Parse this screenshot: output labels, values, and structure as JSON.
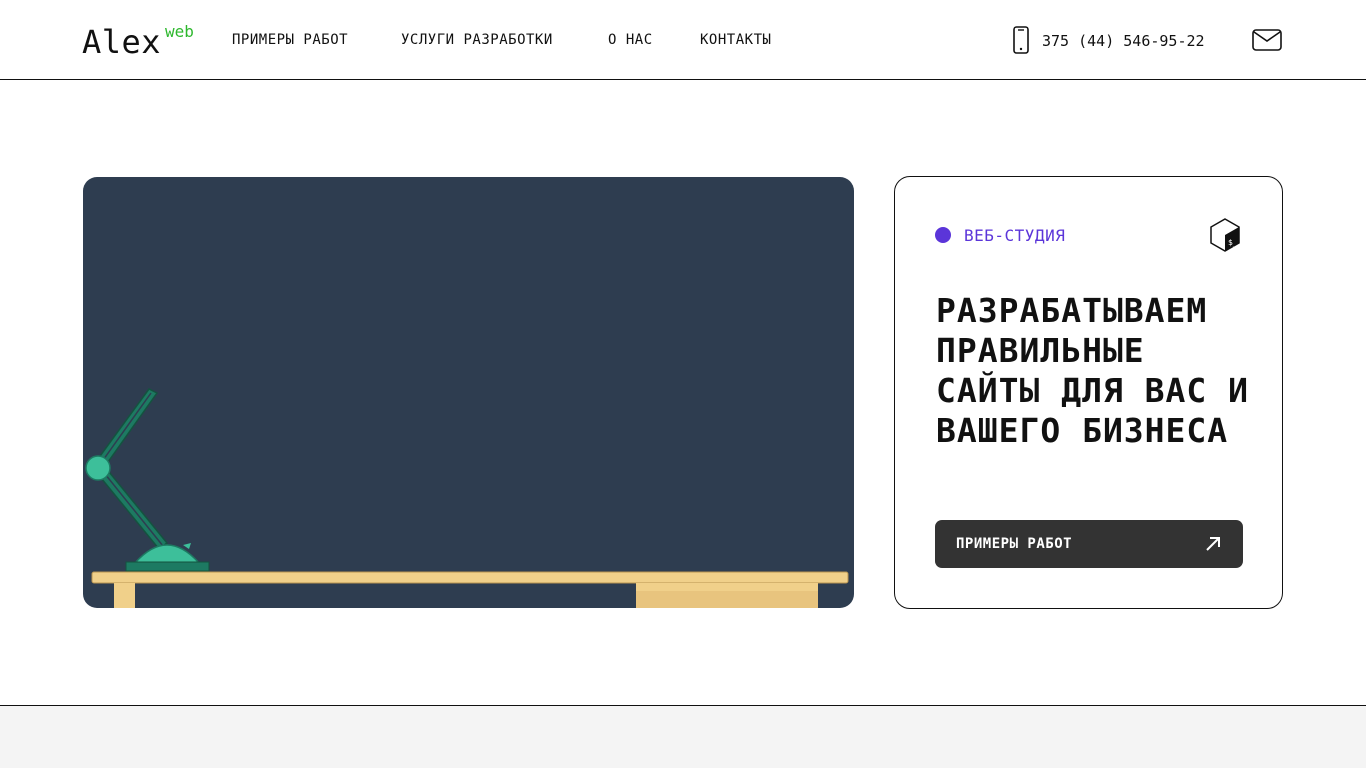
{
  "header": {
    "logo": "Alex",
    "logo_sup": "web",
    "nav": [
      {
        "label": "ПРИМЕРЫ РАБОТ"
      },
      {
        "label": "УСЛУГИ РАЗРАБОТКИ"
      },
      {
        "label": "О НАС"
      },
      {
        "label": "КОНТАКТЫ"
      }
    ],
    "phone": "375 (44) 546-95-22",
    "phone_icon": "phone-icon",
    "mail_icon": "mail-icon"
  },
  "hero": {
    "illustration": "desk-lamp-illustration",
    "badge": "ВЕБ-СТУДИЯ",
    "badge_icon": "terminal-cube-icon",
    "headline": "РАЗРАБАТЫВАЕМ ПРАВИЛЬНЫЕ САЙТЫ ДЛЯ ВАС И ВАШЕГО БИЗНЕСА",
    "cta_label": "ПРИМЕРЫ РАБОТ",
    "cta_icon": "arrow-up-right-icon"
  },
  "colors": {
    "accent": "#5b35d9",
    "logo_accent": "#2eb82e",
    "scene_bg": "#2e3d50",
    "button_bg": "#333333"
  }
}
